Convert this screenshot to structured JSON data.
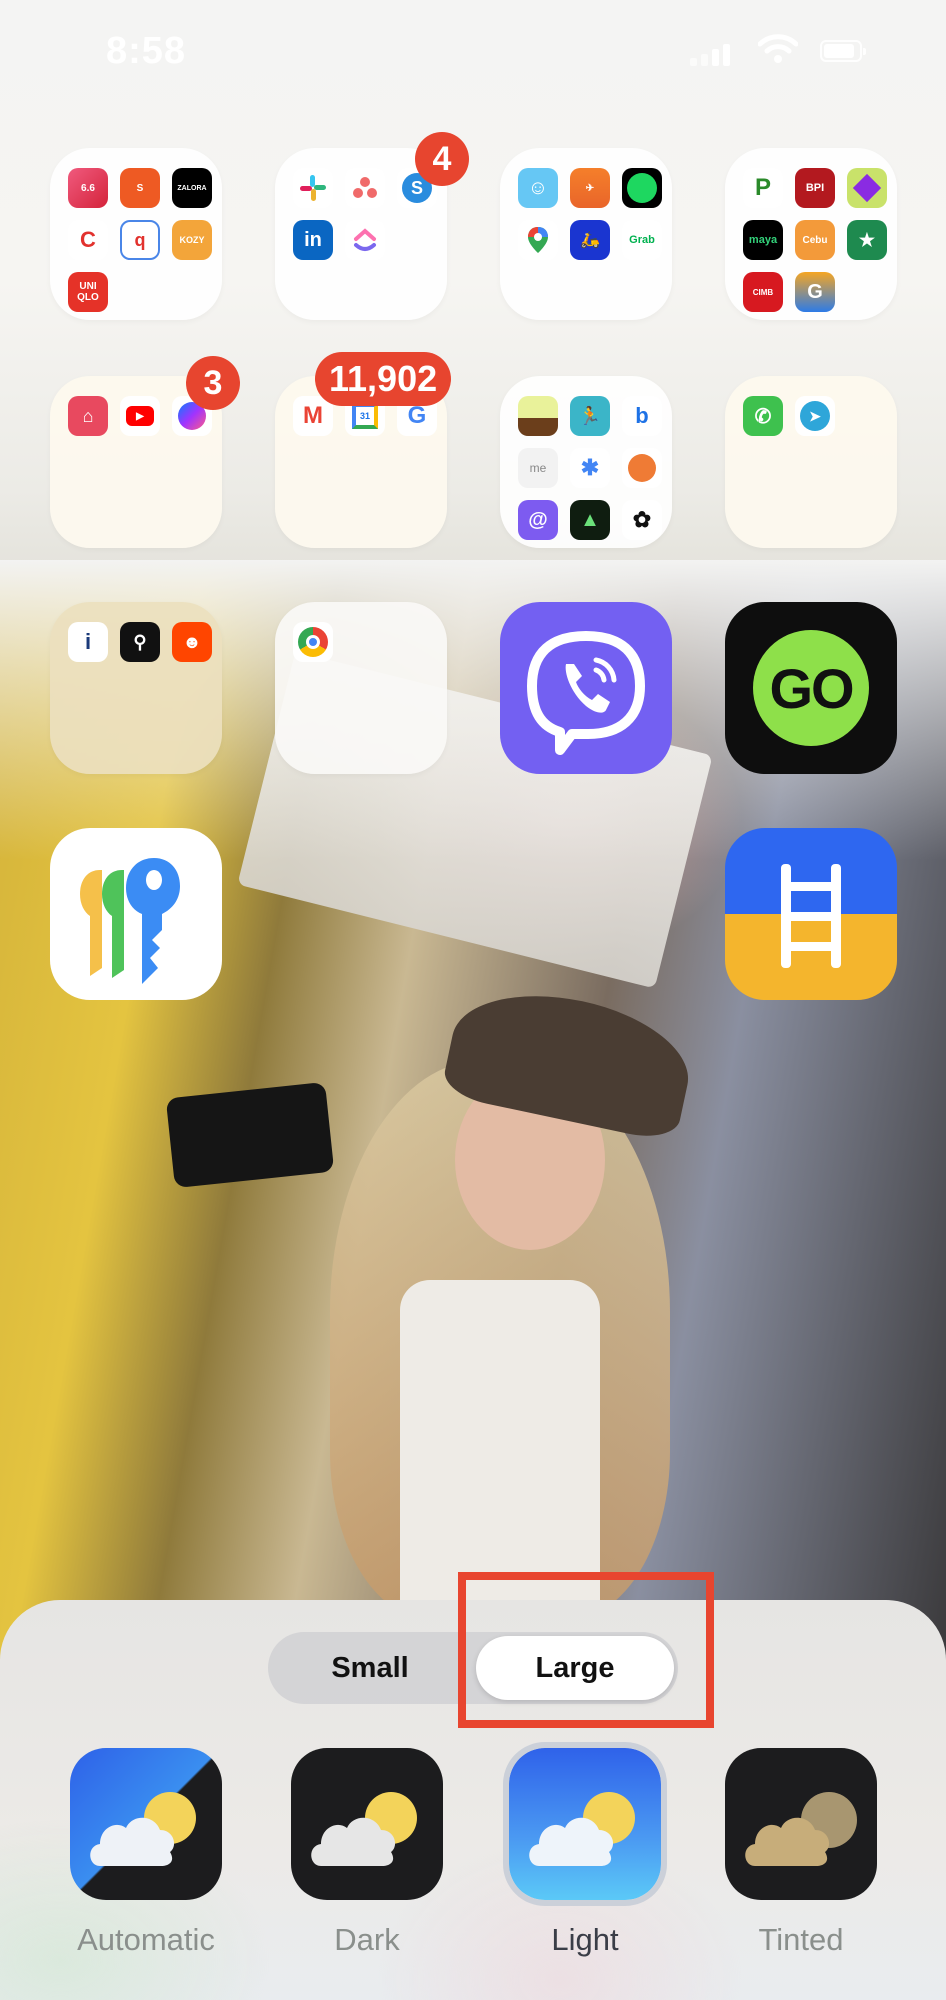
{
  "status_bar": {
    "time": "8:58",
    "signal_icon": "cellular-signal-icon",
    "wifi_icon": "wifi-icon",
    "battery_icon": "battery-icon"
  },
  "home_screen": {
    "rows": [
      [
        {
          "type": "folder",
          "name": "shopping-folder",
          "badge": null,
          "apps": [
            "Shopee 6.6",
            "Shopee 6.6-7.7",
            "Zalora",
            "Carousell",
            "Search app",
            "Kozy",
            "Uniqlo"
          ]
        },
        {
          "type": "folder",
          "name": "work-folder",
          "badge": "4",
          "apps": [
            "Slack",
            "Asana",
            "Skype",
            "LinkedIn",
            "ClickUp"
          ]
        },
        {
          "type": "folder",
          "name": "travel-folder",
          "badge": null,
          "apps": [
            "Waze",
            "Lalamove",
            "Spotify",
            "Google Maps",
            "Angkas",
            "Grab"
          ]
        },
        {
          "type": "folder",
          "name": "finance-folder",
          "badge": null,
          "apps": [
            "PayMaya P",
            "BPI",
            "Maybank",
            "Maya",
            "Cebu Pacific",
            "Starbucks",
            "CIMB",
            "GCash"
          ]
        }
      ],
      [
        {
          "type": "folder",
          "name": "social-folder",
          "badge": "3",
          "apps": [
            "Airbnb",
            "YouTube",
            "Messenger"
          ]
        },
        {
          "type": "folder",
          "name": "google-folder",
          "badge": "11,902",
          "apps": [
            "Gmail",
            "Google Calendar",
            "Google"
          ]
        },
        {
          "type": "folder",
          "name": "utilities-folder",
          "badge": null,
          "apps": [
            "Forest",
            "Runner",
            "Bing",
            "me",
            "Google Assistant",
            "Orange app",
            "Life360",
            "AllTrails",
            "ChatGPT"
          ]
        },
        {
          "type": "folder",
          "name": "messaging-folder",
          "badge": null,
          "apps": [
            "WhatsApp",
            "Telegram"
          ]
        }
      ],
      [
        {
          "type": "folder",
          "name": "misc-folder",
          "badge": null,
          "apps": [
            "Info app",
            "Adidas Running",
            "Reddit"
          ]
        },
        {
          "type": "folder",
          "name": "browser-folder",
          "badge": null,
          "apps": [
            "Chrome"
          ]
        },
        {
          "type": "app",
          "name": "Viber"
        },
        {
          "type": "app",
          "name": "GO",
          "label_glyph": "GO"
        }
      ],
      [
        {
          "type": "app",
          "name": "Passwords"
        },
        {
          "type": "app",
          "name": "Ladder"
        }
      ]
    ]
  },
  "customize_panel": {
    "size_options": [
      "Small",
      "Large"
    ],
    "selected_size": "Large",
    "styles": [
      {
        "label": "Automatic",
        "icon": "weather-automatic-icon"
      },
      {
        "label": "Dark",
        "icon": "weather-dark-icon"
      },
      {
        "label": "Light",
        "icon": "weather-light-icon"
      },
      {
        "label": "Tinted",
        "icon": "weather-tinted-icon"
      }
    ],
    "selected_style": "Light",
    "highlight_color": "#e8452f"
  },
  "colors": {
    "badge": "#e7452f",
    "viber": "#7360f2",
    "go_green": "#8ee04a"
  }
}
